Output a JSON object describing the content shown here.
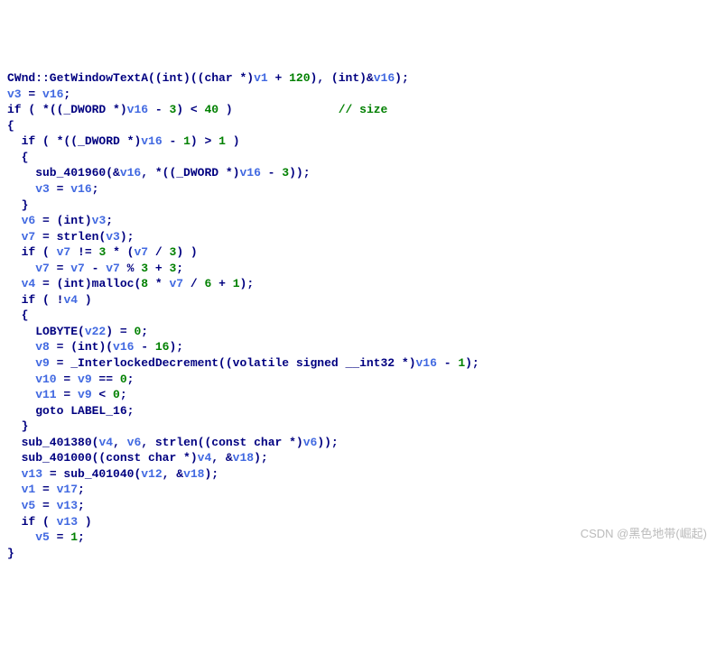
{
  "code": {
    "l1a": "CWnd::GetWindowTextA",
    "l1b": "((",
    "l1c": "int",
    "l1d": ")((",
    "l1e": "char",
    "l1f": " *)",
    "l1g": "v1",
    "l1h": " + ",
    "l1i": "120",
    "l1j": "), (",
    "l1k": "int",
    "l1l": ")&",
    "l1m": "v16",
    "l1n": ");",
    "l2a": "v3",
    "l2b": " = ",
    "l2c": "v16",
    "l2d": ";",
    "l3a": "if",
    "l3b": " ( *((",
    "l3c": "_DWORD",
    "l3d": " *)",
    "l3e": "v16",
    "l3f": " - ",
    "l3g": "3",
    "l3h": ") < ",
    "l3i": "40",
    "l3j": " )",
    "l3cmt": "// size",
    "l4": "{",
    "l5a": "  if",
    "l5b": " ( *((",
    "l5c": "_DWORD",
    "l5d": " *)",
    "l5e": "v16",
    "l5f": " - ",
    "l5g": "1",
    "l5h": ") > ",
    "l5i": "1",
    "l5j": " )",
    "l6": "  {",
    "l7a": "    sub_401960",
    "l7b": "(&",
    "l7c": "v16",
    "l7d": ", *((",
    "l7e": "_DWORD",
    "l7f": " *)",
    "l7g": "v16",
    "l7h": " - ",
    "l7i": "3",
    "l7j": "));",
    "l8a": "    v3",
    "l8b": " = ",
    "l8c": "v16",
    "l8d": ";",
    "l9": "  }",
    "l10a": "  v6",
    "l10b": " = (",
    "l10c": "int",
    "l10d": ")",
    "l10e": "v3",
    "l10f": ";",
    "l11a": "  v7",
    "l11b": " = ",
    "l11c": "strlen",
    "l11d": "(",
    "l11e": "v3",
    "l11f": ");",
    "l12a": "  if",
    "l12b": " ( ",
    "l12c": "v7",
    "l12d": " != ",
    "l12e": "3",
    "l12f": " * (",
    "l12g": "v7",
    "l12h": " / ",
    "l12i": "3",
    "l12j": ") )",
    "l13a": "    v7",
    "l13b": " = ",
    "l13c": "v7",
    "l13d": " - ",
    "l13e": "v7",
    "l13f": " % ",
    "l13g": "3",
    "l13h": " + ",
    "l13i": "3",
    "l13j": ";",
    "l14a": "  v4",
    "l14b": " = (",
    "l14c": "int",
    "l14d": ")",
    "l14e": "malloc",
    "l14f": "(",
    "l14g": "8",
    "l14h": " * ",
    "l14i": "v7",
    "l14j": " / ",
    "l14k": "6",
    "l14l": " + ",
    "l14m": "1",
    "l14n": ");",
    "l15a": "  if",
    "l15b": " ( !",
    "l15c": "v4",
    "l15d": " )",
    "l16": "  {",
    "l17a": "    LOBYTE",
    "l17b": "(",
    "l17c": "v22",
    "l17d": ") = ",
    "l17e": "0",
    "l17f": ";",
    "l18a": "    v8",
    "l18b": " = (",
    "l18c": "int",
    "l18d": ")(",
    "l18e": "v16",
    "l18f": " - ",
    "l18g": "16",
    "l18h": ");",
    "l19a": "    v9",
    "l19b": " = ",
    "l19c": "_InterlockedDecrement",
    "l19d": "((",
    "l19e": "volatile signed __int32",
    "l19f": " *)",
    "l19g": "v16",
    "l19h": " - ",
    "l19i": "1",
    "l19j": ");",
    "l20a": "    v10",
    "l20b": " = ",
    "l20c": "v9",
    "l20d": " == ",
    "l20e": "0",
    "l20f": ";",
    "l21a": "    v11",
    "l21b": " = ",
    "l21c": "v9",
    "l21d": " < ",
    "l21e": "0",
    "l21f": ";",
    "l22a": "    goto",
    "l22b": " LABEL_16;",
    "l23": "  }",
    "l24a": "  sub_401380",
    "l24b": "(",
    "l24c": "v4",
    "l24d": ", ",
    "l24e": "v6",
    "l24f": ", ",
    "l24g": "strlen",
    "l24h": "((",
    "l24i": "const char",
    "l24j": " *)",
    "l24k": "v6",
    "l24l": "));",
    "l25a": "  sub_401000",
    "l25b": "((",
    "l25c": "const char",
    "l25d": " *)",
    "l25e": "v4",
    "l25f": ", &",
    "l25g": "v18",
    "l25h": ");",
    "l26a": "  v13",
    "l26b": " = ",
    "l26c": "sub_401040",
    "l26d": "(",
    "l26e": "v12",
    "l26f": ", &",
    "l26g": "v18",
    "l26h": ");",
    "l27a": "  v1",
    "l27b": " = ",
    "l27c": "v17",
    "l27d": ";",
    "l28a": "  v5",
    "l28b": " = ",
    "l28c": "v13",
    "l28d": ";",
    "l29a": "  if",
    "l29b": " ( ",
    "l29c": "v13",
    "l29d": " )",
    "l30a": "    v5",
    "l30b": " = ",
    "l30c": "1",
    "l30d": ";",
    "l31": "}"
  },
  "watermark": "CSDN @黑色地带(崛起)"
}
